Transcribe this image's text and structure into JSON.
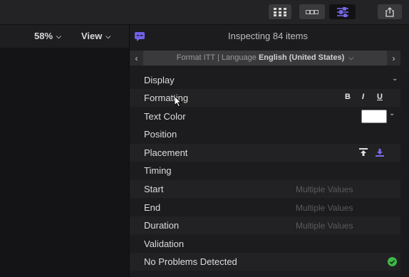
{
  "toolbar": {
    "zoom_label": "58%",
    "view_label": "View"
  },
  "inspector": {
    "title": "Inspecting 84 items",
    "format_prefix": "Format ITT | Language",
    "language": "English (United States)",
    "sections": {
      "display": "Display",
      "formatting": "Formatting",
      "text_color": "Text Color",
      "position": "Position",
      "placement": "Placement",
      "timing": "Timing",
      "start": "Start",
      "end": "End",
      "duration": "Duration",
      "validation": "Validation",
      "status": "No Problems Detected"
    },
    "multiple_values": "Multiple Values",
    "format_buttons": {
      "bold": "B",
      "italic": "I",
      "underline": "U"
    },
    "text_color_value": "#ffffff",
    "status_color": "#3fb948",
    "accent_color": "#6f61e8"
  }
}
